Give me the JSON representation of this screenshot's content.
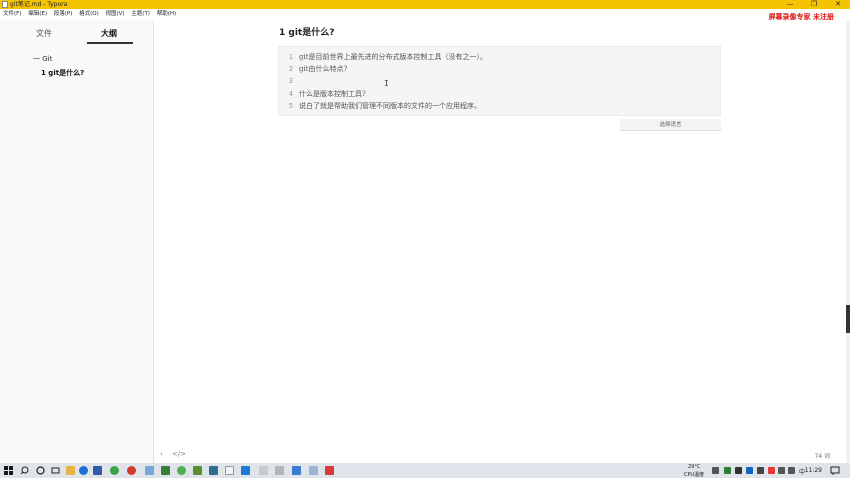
{
  "window": {
    "title": "git笔记.md - Typora",
    "controls": [
      "—",
      "❐",
      "✕"
    ]
  },
  "menu": [
    "文件(F)",
    "编辑(E)",
    "段落(P)",
    "格式(O)",
    "视图(V)",
    "主题(T)",
    "帮助(H)"
  ],
  "watermark": "屏幕录像专家 未注册",
  "sidebar": {
    "tabs": [
      "文件",
      "大纲"
    ],
    "outline": [
      {
        "label": "一 Git"
      },
      {
        "label": "1 git是什么?"
      }
    ]
  },
  "document": {
    "heading": "1  git是什么?",
    "code_lines": [
      {
        "n": "1",
        "text": "git是目前世界上最先进的分布式版本控制工具（没有之一）。"
      },
      {
        "n": "2",
        "text": "git由什么特点?"
      },
      {
        "n": "3",
        "text": ""
      },
      {
        "n": "4",
        "text": "什么是版本控制工具?"
      },
      {
        "n": "5",
        "text": "说白了就是帮助我们管理不同版本的文件的一个应用程序。"
      }
    ],
    "language_select": "选择语言"
  },
  "statusbar": {
    "back_icon": "‹",
    "source_icon": "</>",
    "word_count": "74 词"
  },
  "taskbar": {
    "weather_temp": "29°C",
    "weather_label": "CPU温度",
    "ime": "中",
    "time": "11:29"
  }
}
